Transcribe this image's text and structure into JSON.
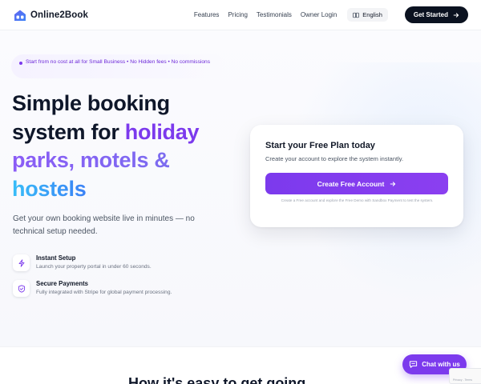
{
  "brand": {
    "name": "Online2Book",
    "logo_letters": "O"
  },
  "nav": {
    "links": [
      "Features",
      "Pricing",
      "Testimonials",
      "Owner Login"
    ],
    "language": "English",
    "cta_label": "Get Started"
  },
  "hero": {
    "badge_text": "Start from no cost at all for Small Business • No Hidden fees • No commissions",
    "headline_line1": "Simple booking",
    "headline_line2a": "system for ",
    "headline_line2b": "holiday",
    "headline_line3": "parks, motels &",
    "headline_line4": "hostels",
    "subtext": "Get your own booking website live in minutes — no technical setup needed.",
    "features": [
      {
        "title": "Instant Setup",
        "desc": "Launch your property portal in under 60 seconds.",
        "icon": "lightning-icon"
      },
      {
        "title": "Secure Payments",
        "desc": "Fully integrated with Stripe for global payment processing.",
        "icon": "shield-check-icon"
      }
    ]
  },
  "signup_card": {
    "title": "Start your Free Plan today",
    "subtitle": "Create your account to explore the system instantly.",
    "button_label": "Create Free Account",
    "fine_print": "Create a Free account and explore the Free Demo with Sandbox Payment to test the system."
  },
  "next_section": {
    "heading": "How it's easy to get going"
  },
  "chat": {
    "label": "Chat with us"
  },
  "recaptcha": {
    "label": "Privacy - Terms"
  },
  "colors": {
    "accent": "#7c3aed",
    "dark": "#0b1220",
    "blue": "#3b82f6"
  }
}
